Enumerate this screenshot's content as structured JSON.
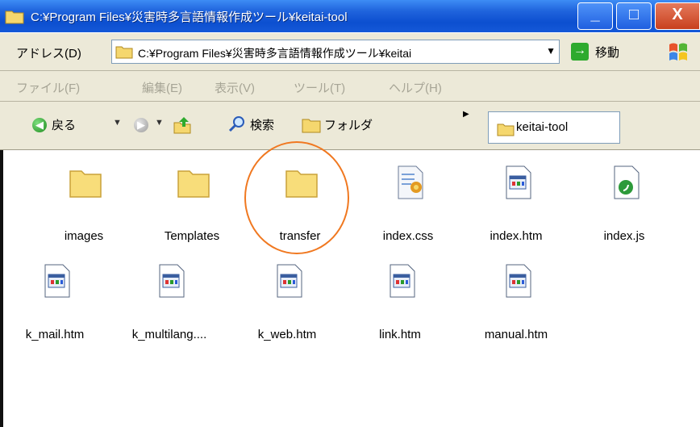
{
  "window": {
    "title": "C:¥Program Files¥災害時多言語情報作成ツール¥keitai-tool",
    "min_glyph": "_",
    "max_glyph": "□",
    "close_glyph": "X"
  },
  "address": {
    "label": "アドレス(D)",
    "value": "C:¥Program Files¥災害時多言語情報作成ツール¥keitai",
    "dropdown": "▼",
    "go_label": "移動"
  },
  "menu": [
    "ファイル(F)",
    "編集(E)",
    "表示(V)",
    "ツール(T)",
    "ヘルプ(H)"
  ],
  "toolbar": {
    "back_label": "戻る",
    "search_label": "検索",
    "folders_label": "フォルダ",
    "tab_label": "keitai-tool"
  },
  "files": [
    {
      "name": "images",
      "type": "folder"
    },
    {
      "name": "Templates",
      "type": "folder"
    },
    {
      "name": "transfer",
      "type": "folder"
    },
    {
      "name": "index.css",
      "type": "css"
    },
    {
      "name": "index.htm",
      "type": "htm"
    },
    {
      "name": "index.js",
      "type": "js"
    },
    {
      "name": "k_mail.htm",
      "type": "htm"
    },
    {
      "name": "k_multilang....",
      "type": "htm"
    },
    {
      "name": "k_web.htm",
      "type": "htm"
    },
    {
      "name": "link.htm",
      "type": "htm"
    },
    {
      "name": "manual.htm",
      "type": "htm"
    }
  ],
  "colors": {
    "titlebar": "#0c4fd0",
    "highlight": "#f07820",
    "menu_disabled": "#a7a596"
  }
}
